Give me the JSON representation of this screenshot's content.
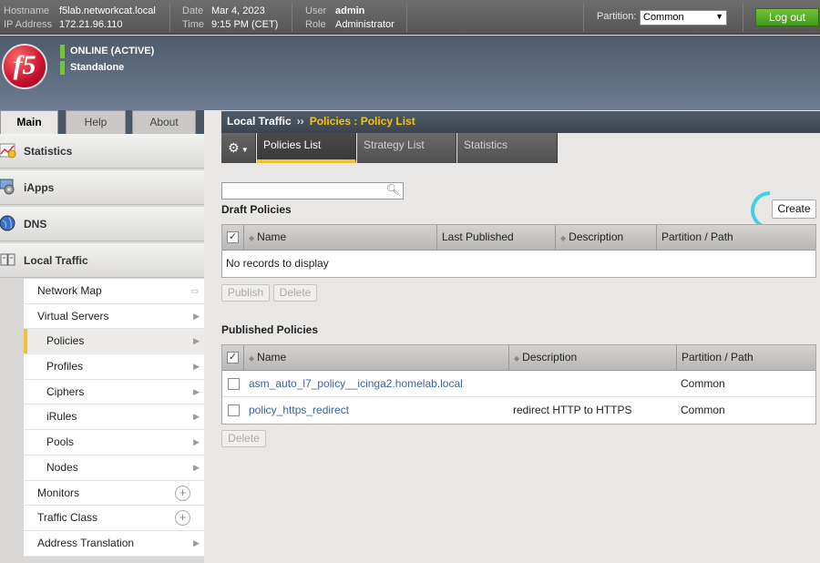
{
  "topbar": {
    "hostname_label": "Hostname",
    "hostname": "f5lab.networkcat.local",
    "ip_label": "IP Address",
    "ip": "172.21.96.110",
    "date_label": "Date",
    "date": "Mar 4, 2023",
    "time_label": "Time",
    "time": "9:15 PM (CET)",
    "user_label": "User",
    "user": "admin",
    "role_label": "Role",
    "role": "Administrator",
    "partition_label": "Partition:",
    "partition_value": "Common",
    "logout_label": "Log out"
  },
  "banner": {
    "logo_text": "f5",
    "status": "ONLINE (ACTIVE)",
    "mode": "Standalone"
  },
  "left_tabs": [
    "Main",
    "Help",
    "About"
  ],
  "sidebar": {
    "sections": [
      "Statistics",
      "iApps",
      "DNS",
      "Local Traffic"
    ],
    "items": [
      {
        "label": "Network Map",
        "level": 1
      },
      {
        "label": "Virtual Servers",
        "level": 1
      },
      {
        "label": "Policies",
        "level": 2,
        "active": true
      },
      {
        "label": "Profiles",
        "level": 2
      },
      {
        "label": "Ciphers",
        "level": 2
      },
      {
        "label": "iRules",
        "level": 2
      },
      {
        "label": "Pools",
        "level": 2
      },
      {
        "label": "Nodes",
        "level": 2
      },
      {
        "label": "Monitors",
        "level": 1
      },
      {
        "label": "Traffic Class",
        "level": 1
      },
      {
        "label": "Address Translation",
        "level": 1
      }
    ]
  },
  "breadcrumb": {
    "root": "Local Traffic",
    "separator": "››",
    "current": "Policies : Policy List"
  },
  "subtabs": [
    "Policies List",
    "Strategy List",
    "Statistics"
  ],
  "draft": {
    "title": "Draft Policies",
    "columns": [
      "Name",
      "Last Published",
      "Description",
      "Partition / Path"
    ],
    "empty_text": "No records to display",
    "publish_label": "Publish",
    "delete_label": "Delete"
  },
  "create_label": "Create",
  "published": {
    "title": "Published Policies",
    "columns": [
      "Name",
      "Description",
      "Partition / Path"
    ],
    "rows": [
      {
        "name": "asm_auto_l7_policy__icinga2.homelab.local",
        "description": "",
        "partition": "Common"
      },
      {
        "name": "policy_https_redirect",
        "description": "redirect HTTP to HTTPS",
        "partition": "Common"
      }
    ],
    "delete_label": "Delete"
  }
}
